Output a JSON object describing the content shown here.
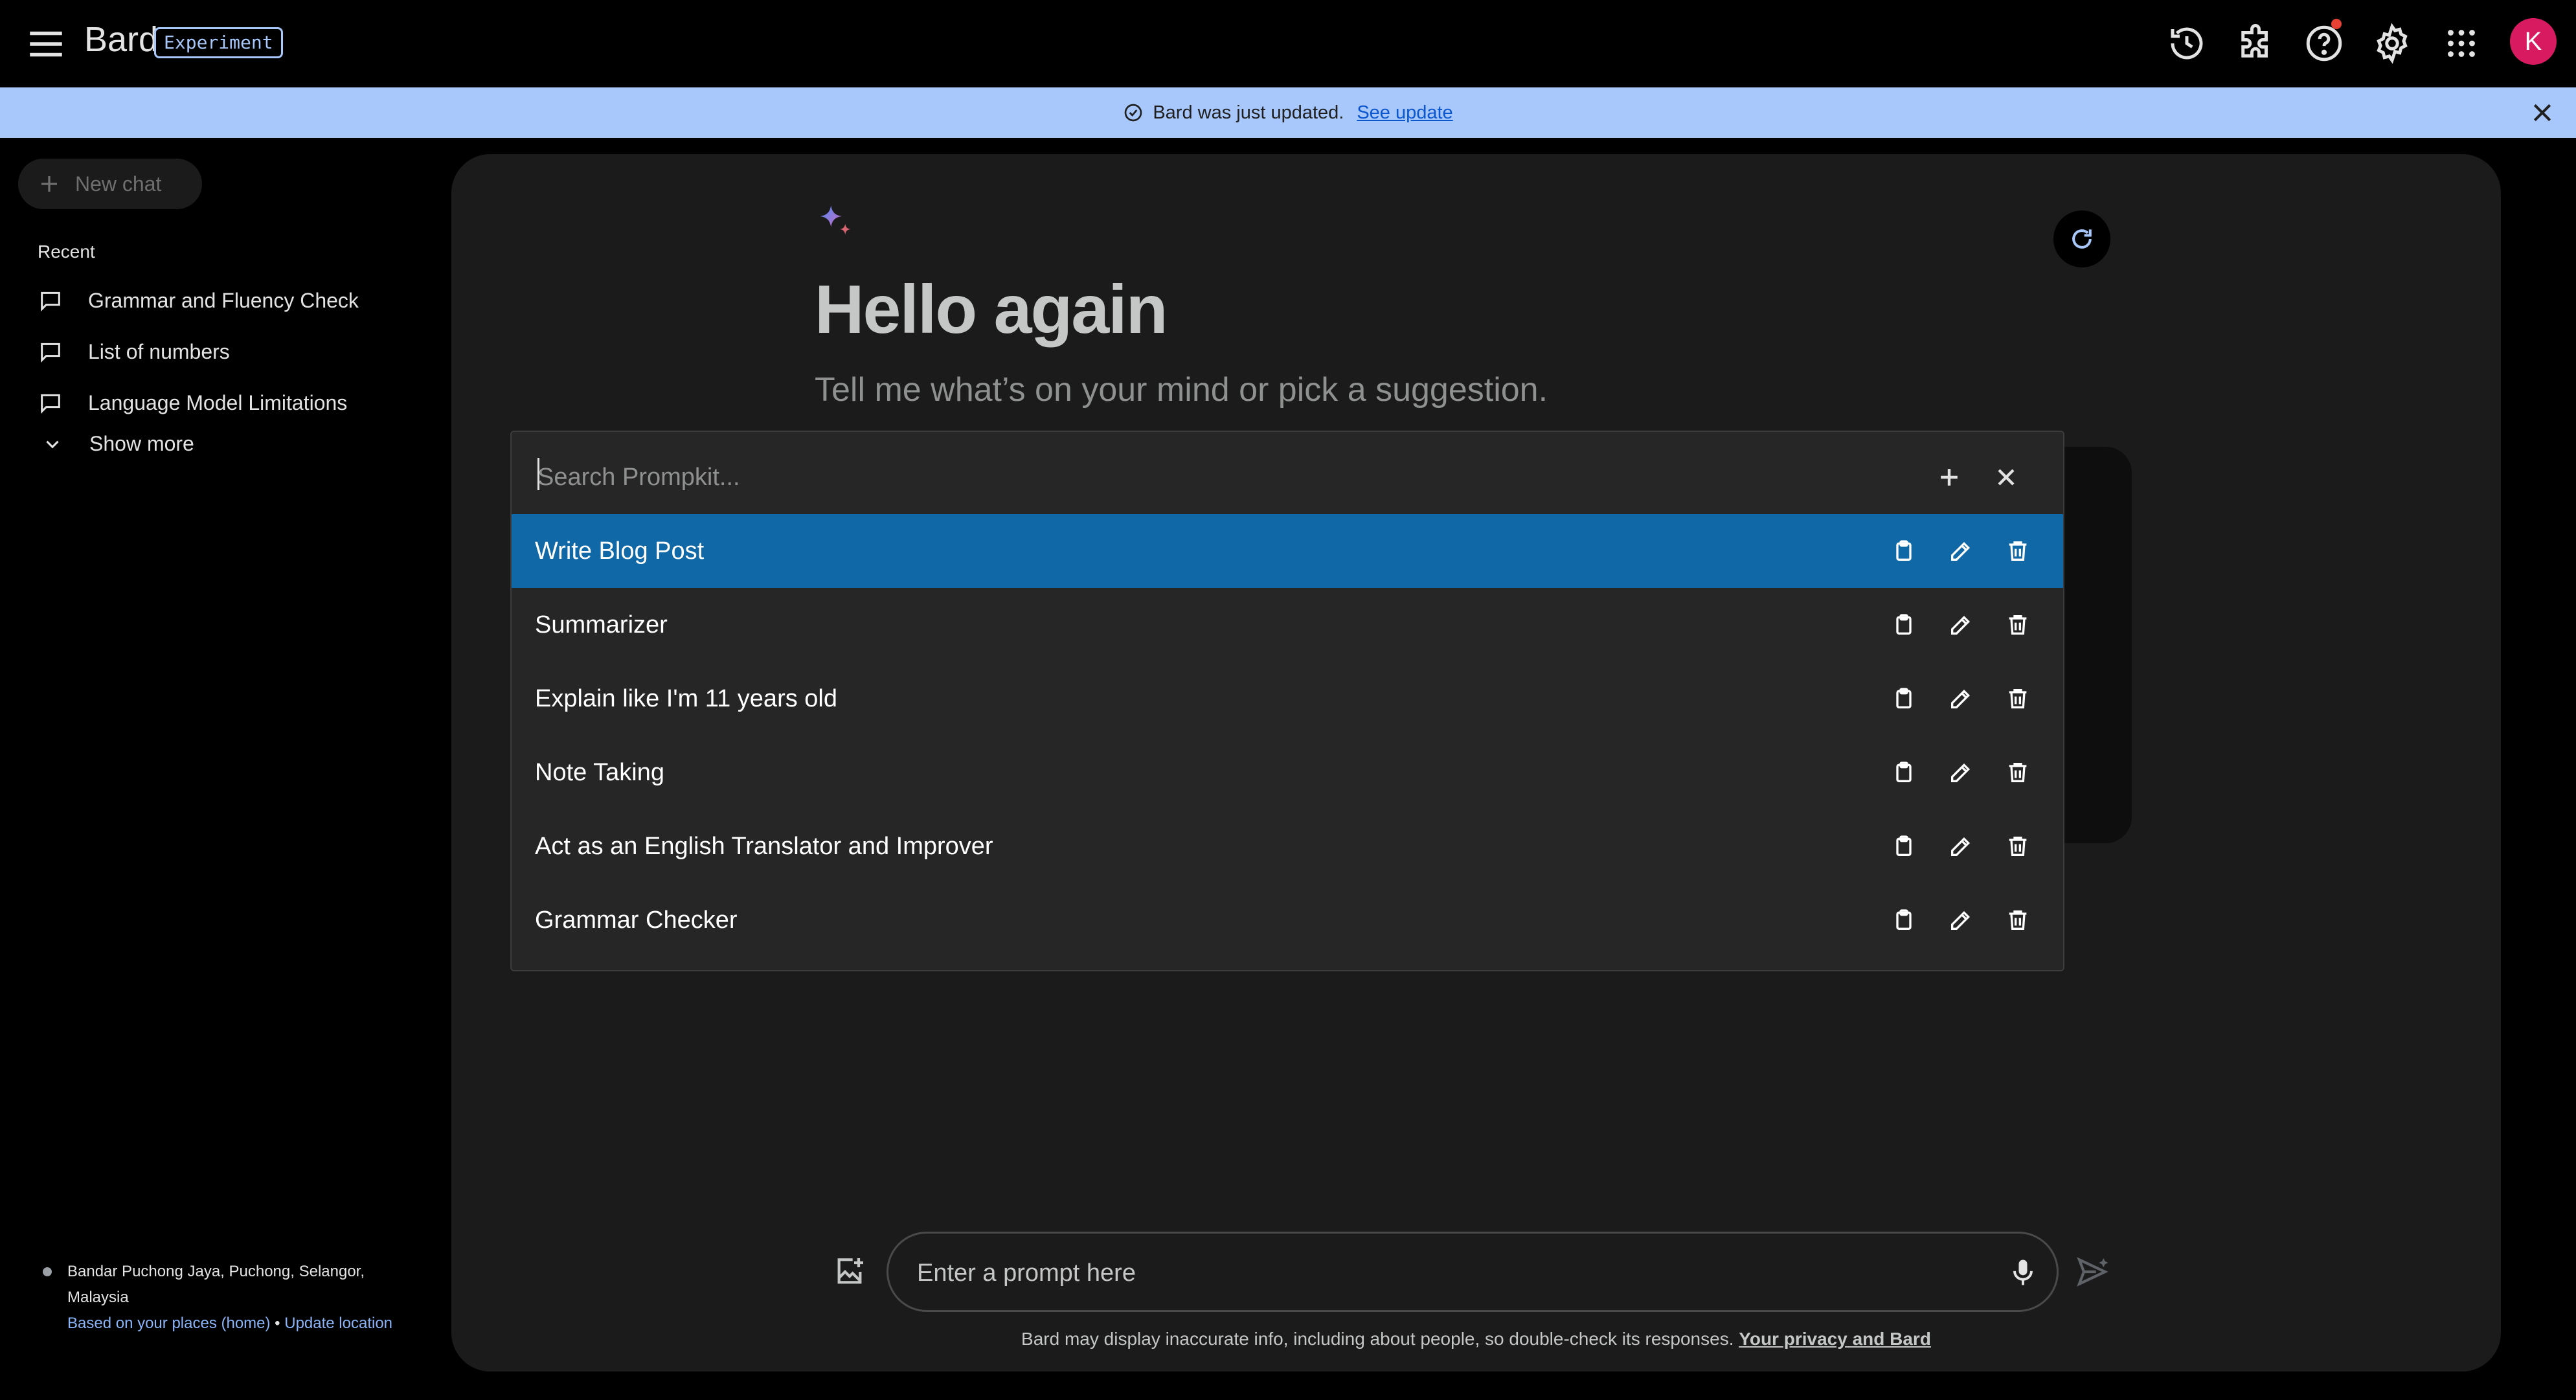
{
  "header": {
    "app_name": "Bard",
    "badge": "Experiment",
    "avatar_letter": "K",
    "icons": [
      "menu-icon",
      "history-icon",
      "extension-icon",
      "help-icon",
      "settings-icon",
      "apps-icon"
    ]
  },
  "banner": {
    "text": "Bard was just updated.",
    "link": "See update"
  },
  "sidebar": {
    "new_chat": "New chat",
    "recent_label": "Recent",
    "recent": [
      {
        "label": "Grammar and Fluency Check"
      },
      {
        "label": "List of numbers"
      },
      {
        "label": "Language Model Limitations"
      }
    ],
    "show_more": "Show more",
    "location": {
      "place": "Bandar Puchong Jaya, Puchong, Selangor, Malaysia",
      "basis": "Based on your places (home)",
      "separator": "•",
      "update": "Update location"
    }
  },
  "main": {
    "greeting": "Hello again",
    "subtitle": "Tell me what’s on your mind or pick a suggestion."
  },
  "prompt_kit": {
    "search_placeholder": "Search Prompkit...",
    "items": [
      {
        "label": "Write Blog Post",
        "selected": true
      },
      {
        "label": "Summarizer",
        "selected": false
      },
      {
        "label": "Explain like I'm 11 years old",
        "selected": false
      },
      {
        "label": "Note Taking",
        "selected": false
      },
      {
        "label": "Act as an English Translator and Improver",
        "selected": false
      },
      {
        "label": "Grammar Checker",
        "selected": false
      }
    ]
  },
  "input": {
    "placeholder": "Enter a prompt here"
  },
  "footer": {
    "disclaimer": "Bard may display inaccurate info, including about people, so double-check its responses.",
    "link": "Your privacy and Bard"
  },
  "colors": {
    "accent": "#a8c7fa",
    "selected_row": "#1068a7",
    "avatar": "#d81b60",
    "notification": "#e94235"
  }
}
